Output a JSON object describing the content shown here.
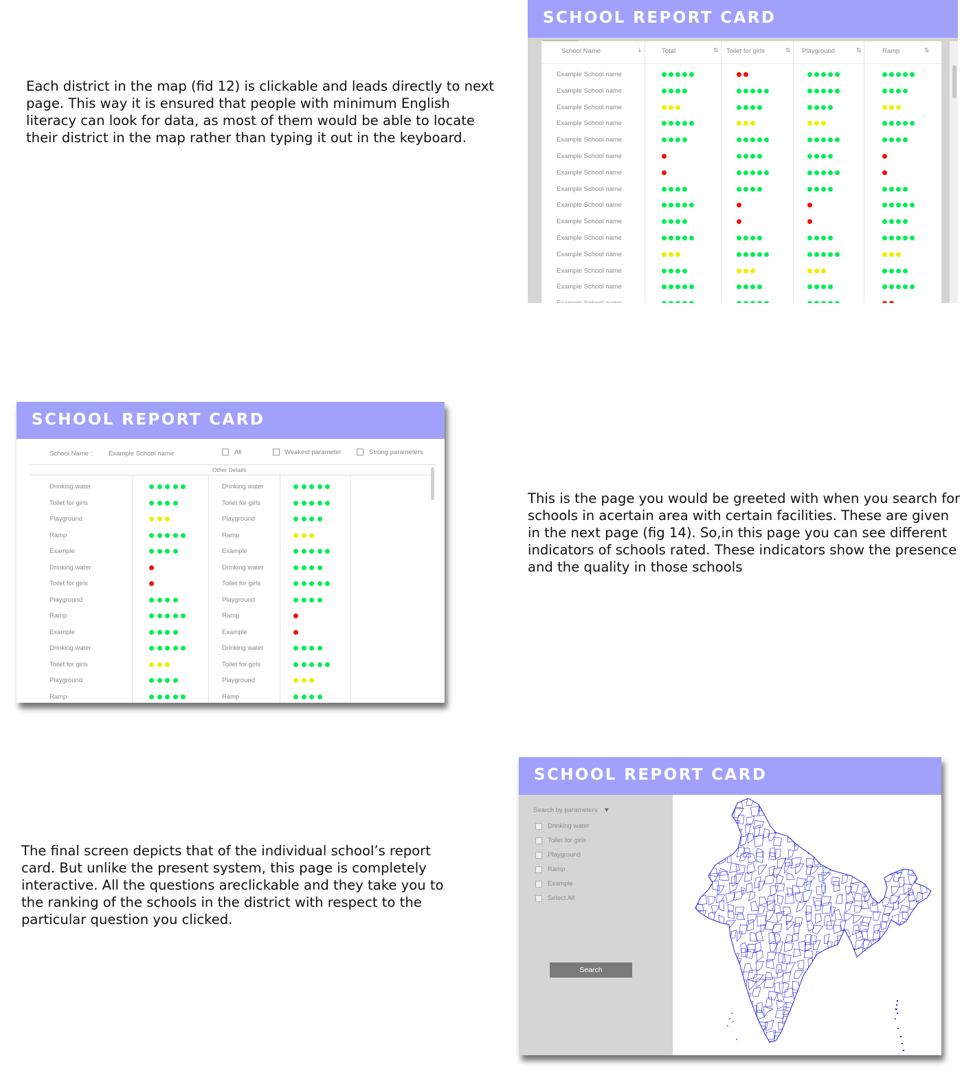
{
  "descriptions": {
    "p1": "Each district in the map (fid 12) is clickable and leads directly to next page. This way it is ensured that people with minimum English literacy can look for data, as most of them would be able to locate their district in the map rather than typing it out in the keyboard.",
    "p2": "This is the page you would be greeted with when you search for schools in acertain area with certain facilities. These are given in the next page (fig 14). So,in this page you can see different indicators of schools rated. These indicators show the presence and the quality in those schools",
    "p3": "The final screen depicts that of the individual school’s report card. But unlike the present system, this page is completely interactive. All the questions areclickable and they take you to the ranking of the schools in the district with respect to the particular question you clicked."
  },
  "colors": {
    "header": "#a1a1fc",
    "green": "#00ee55",
    "yellow": "#eeee00",
    "red": "#ee1100",
    "map_line": "#2222dd"
  },
  "ranking": {
    "title": "SCHOOL REPORT CARD",
    "columns": [
      "School Name",
      "Total",
      "Toilet for girls",
      "Playground",
      "Ramp"
    ],
    "rows": [
      {
        "name": "Example School name",
        "ratings": [
          [
            5,
            "green"
          ],
          [
            2,
            "red"
          ],
          [
            5,
            "green"
          ],
          [
            5,
            "green"
          ]
        ]
      },
      {
        "name": "Example School name",
        "ratings": [
          [
            4,
            "green"
          ],
          [
            5,
            "green"
          ],
          [
            5,
            "green"
          ],
          [
            4,
            "green"
          ]
        ]
      },
      {
        "name": "Example School name",
        "ratings": [
          [
            3,
            "yellow"
          ],
          [
            4,
            "green"
          ],
          [
            4,
            "green"
          ],
          [
            3,
            "yellow"
          ]
        ]
      },
      {
        "name": "Example School name",
        "ratings": [
          [
            5,
            "green"
          ],
          [
            3,
            "yellow"
          ],
          [
            3,
            "yellow"
          ],
          [
            5,
            "green"
          ]
        ]
      },
      {
        "name": "Example School name",
        "ratings": [
          [
            4,
            "green"
          ],
          [
            5,
            "green"
          ],
          [
            5,
            "green"
          ],
          [
            4,
            "green"
          ]
        ]
      },
      {
        "name": "Example School name",
        "ratings": [
          [
            1,
            "red"
          ],
          [
            4,
            "green"
          ],
          [
            4,
            "green"
          ],
          [
            1,
            "red"
          ]
        ]
      },
      {
        "name": "Example School name",
        "ratings": [
          [
            1,
            "red"
          ],
          [
            5,
            "green"
          ],
          [
            5,
            "green"
          ],
          [
            1,
            "red"
          ]
        ]
      },
      {
        "name": "Example School name",
        "ratings": [
          [
            4,
            "green"
          ],
          [
            4,
            "green"
          ],
          [
            4,
            "green"
          ],
          [
            4,
            "green"
          ]
        ]
      },
      {
        "name": "Example School name",
        "ratings": [
          [
            5,
            "green"
          ],
          [
            1,
            "red"
          ],
          [
            1,
            "red"
          ],
          [
            5,
            "green"
          ]
        ]
      },
      {
        "name": "Example School name",
        "ratings": [
          [
            4,
            "green"
          ],
          [
            1,
            "red"
          ],
          [
            1,
            "red"
          ],
          [
            4,
            "green"
          ]
        ]
      },
      {
        "name": "Example School name",
        "ratings": [
          [
            5,
            "green"
          ],
          [
            4,
            "green"
          ],
          [
            4,
            "green"
          ],
          [
            5,
            "green"
          ]
        ]
      },
      {
        "name": "Example School name",
        "ratings": [
          [
            3,
            "yellow"
          ],
          [
            5,
            "green"
          ],
          [
            5,
            "green"
          ],
          [
            3,
            "yellow"
          ]
        ]
      },
      {
        "name": "Example School name",
        "ratings": [
          [
            4,
            "green"
          ],
          [
            3,
            "yellow"
          ],
          [
            3,
            "yellow"
          ],
          [
            4,
            "green"
          ]
        ]
      },
      {
        "name": "Example School name",
        "ratings": [
          [
            5,
            "green"
          ],
          [
            4,
            "green"
          ],
          [
            4,
            "green"
          ],
          [
            5,
            "green"
          ]
        ]
      },
      {
        "name": "Example School name",
        "ratings": [
          [
            5,
            "green"
          ],
          [
            5,
            "green"
          ],
          [
            5,
            "green"
          ],
          [
            2,
            "red"
          ]
        ]
      }
    ]
  },
  "report": {
    "title": "SCHOOL REPORT CARD",
    "school_label": "School Name :",
    "school_value": "Example School name",
    "filters": [
      "All",
      "Weakest parameter",
      "Strong parameters"
    ],
    "section_label": "Other Details",
    "left_rows": [
      {
        "label": "Drinking water",
        "rating": [
          5,
          "green"
        ]
      },
      {
        "label": "Toilet for girls",
        "rating": [
          4,
          "green"
        ]
      },
      {
        "label": "Playground",
        "rating": [
          3,
          "yellow"
        ]
      },
      {
        "label": "Ramp",
        "rating": [
          5,
          "green"
        ]
      },
      {
        "label": "Example",
        "rating": [
          4,
          "green"
        ]
      },
      {
        "label": "Drinking water",
        "rating": [
          1,
          "red"
        ]
      },
      {
        "label": "Toilet for girls",
        "rating": [
          1,
          "red"
        ]
      },
      {
        "label": "Playground",
        "rating": [
          4,
          "green"
        ]
      },
      {
        "label": "Ramp",
        "rating": [
          5,
          "green"
        ]
      },
      {
        "label": "Example",
        "rating": [
          4,
          "green"
        ]
      },
      {
        "label": "Drinking water",
        "rating": [
          5,
          "green"
        ]
      },
      {
        "label": "Toilet for girls",
        "rating": [
          3,
          "yellow"
        ]
      },
      {
        "label": "Playground",
        "rating": [
          4,
          "green"
        ]
      },
      {
        "label": "Ramp",
        "rating": [
          5,
          "green"
        ]
      }
    ],
    "right_rows": [
      {
        "label": "Drinking water",
        "rating": [
          5,
          "green"
        ]
      },
      {
        "label": "Toilet for girls",
        "rating": [
          5,
          "green"
        ]
      },
      {
        "label": "Playground",
        "rating": [
          4,
          "green"
        ]
      },
      {
        "label": "Ramp",
        "rating": [
          3,
          "yellow"
        ]
      },
      {
        "label": "Example",
        "rating": [
          5,
          "green"
        ]
      },
      {
        "label": "Drinking water",
        "rating": [
          4,
          "green"
        ]
      },
      {
        "label": "Toilet for girls",
        "rating": [
          5,
          "green"
        ]
      },
      {
        "label": "Playground",
        "rating": [
          4,
          "green"
        ]
      },
      {
        "label": "Ramp",
        "rating": [
          1,
          "red"
        ]
      },
      {
        "label": "Example",
        "rating": [
          1,
          "red"
        ]
      },
      {
        "label": "Drinking water",
        "rating": [
          4,
          "green"
        ]
      },
      {
        "label": "Toilet for girls",
        "rating": [
          5,
          "green"
        ]
      },
      {
        "label": "Playground",
        "rating": [
          3,
          "yellow"
        ]
      },
      {
        "label": "Ramp",
        "rating": [
          4,
          "green"
        ]
      }
    ]
  },
  "search": {
    "title": "SCHOOL REPORT CARD",
    "params_label": "Search by parameters",
    "options": [
      "Drinking water",
      "Toilet for girls",
      "Playground",
      "Ramp",
      "Example",
      "Select All"
    ],
    "button_label": "Search",
    "map_icon": "india-district-map"
  }
}
